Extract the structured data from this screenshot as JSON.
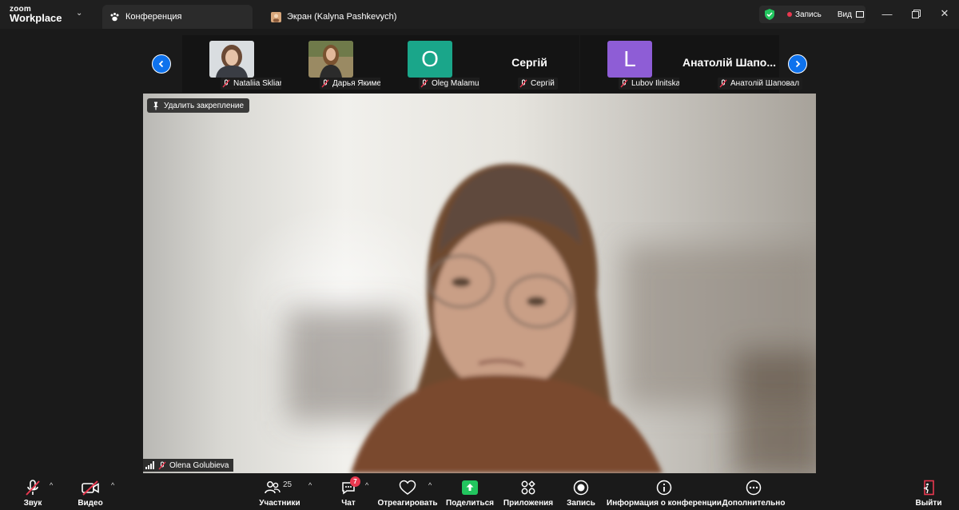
{
  "app": {
    "logo_line1": "zoom",
    "logo_line2": "Workplace"
  },
  "tabs": [
    {
      "label": "Конференция",
      "icon": "paw-icon",
      "active": true
    },
    {
      "label": "Экран (Kalyna Pashkevych)",
      "icon": "avatar-icon",
      "active": false
    }
  ],
  "header": {
    "record_label": "Запись",
    "view_label": "Вид",
    "window_controls": [
      "minimize",
      "restore",
      "close"
    ]
  },
  "participants": [
    {
      "name": "Nataliia Skliarenko",
      "display": "photo",
      "muted": true
    },
    {
      "name": "Дарья Якименко",
      "display": "photo",
      "muted": true
    },
    {
      "name": "Oleg Malamuzh",
      "display": "letter",
      "letter": "O",
      "color": "#1aa68a",
      "muted": true
    },
    {
      "name": "Сергій",
      "display": "name",
      "big_name": "Сергій",
      "muted": true
    },
    {
      "name": "Lubov Ilnitskaya",
      "display": "letter",
      "letter": "L",
      "color": "#8e5dd6",
      "muted": true
    },
    {
      "name": "Анатолій Шаповал",
      "display": "name",
      "big_name": "Анатолій Шапо...",
      "muted": true
    }
  ],
  "main_video": {
    "unpin_label": "Удалить закрепление",
    "speaker_name": "Olena Golubieva"
  },
  "toolbar": {
    "audio_label": "Звук",
    "video_label": "Видео",
    "participants_label": "Участники",
    "participants_count": "25",
    "chat_label": "Чат",
    "chat_badge": "7",
    "react_label": "Отреагировать",
    "share_label": "Поделиться",
    "apps_label": "Приложения",
    "record_label": "Запись",
    "info_label": "Информация о конференции",
    "more_label": "Дополнительно",
    "leave_label": "Выйти"
  },
  "colors": {
    "accent": "#0e72ed",
    "share_green": "#22c55e",
    "danger": "#e8384f"
  }
}
